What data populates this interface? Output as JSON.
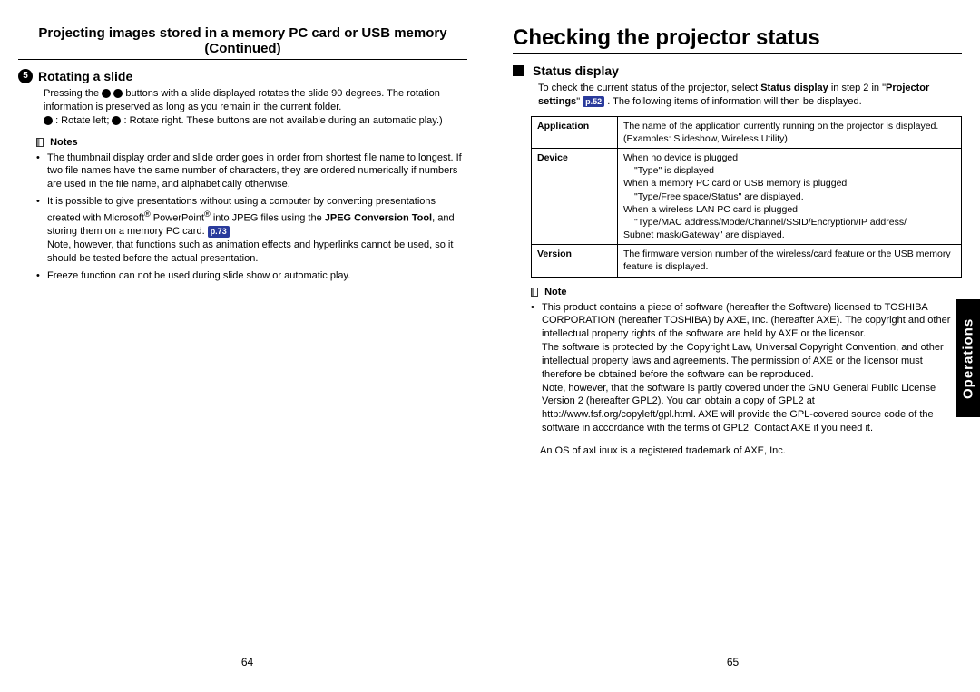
{
  "left": {
    "cont_title": "Projecting images stored in a memory PC card or USB memory (Continued)",
    "step_num": "5",
    "step_title": "Rotating a slide",
    "step_body_1": "Pressing the ",
    "step_body_2": " buttons with a slide displayed rotates the slide 90 degrees. The rotation information is preserved as long as you remain in the current folder.",
    "step_body_3": ": Rotate left; ",
    "step_body_4": ": Rotate right. These buttons are not available during an automatic play.)",
    "notes_label": "Notes",
    "notes": [
      "The thumbnail display order and slide order goes in order from shortest file name to longest. If two file names have the same number of characters, they are ordered numerically if numbers are used in the file name, and alphabetically otherwise.",
      "It is possible to give presentations without using a computer by converting presentations created with Microsoft® PowerPoint® into JPEG files using the JPEG Conversion Tool, and storing them on a memory PC card. p.73\nNote, however, that functions such as animation effects and hyperlinks cannot be used, so it should be tested before the actual presentation.",
      "Freeze function can not be used during slide show or automatic play."
    ],
    "pagenum": "64"
  },
  "right": {
    "title": "Checking the projector status",
    "sec_title": "Status display",
    "intro_1": "To check the current status of the projector, select ",
    "intro_bold": "Status display",
    "intro_2": " in step 2 in \"",
    "intro_bold2": "Projector settings",
    "intro_3": "\" ",
    "pgref": "p.52",
    "intro_4": " . The following items of information will then be displayed.",
    "table": {
      "r1k": "Application",
      "r1v": "The name of the application currently running on the projector is displayed.\n(Examples: Slideshow, Wireless Utility)",
      "r2k": "Device",
      "r2v_l1": "When no device is plugged",
      "r2v_l1b": "\"Type\" is displayed",
      "r2v_l2": "When a memory PC card or USB memory is plugged",
      "r2v_l2b": "\"Type/Free space/Status\" are displayed.",
      "r2v_l3": "When a wireless LAN PC card is plugged",
      "r2v_l3b": "\"Type/MAC address/Mode/Channel/SSID/Encryption/IP address/Subnet mask/Gateway\" are displayed.",
      "r3k": "Version",
      "r3v": "The firmware version number of the wireless/card feature or the USB memory feature is displayed."
    },
    "note_label": "Note",
    "note_body": "This product contains a piece of software (hereafter the Software) licensed to TOSHIBA CORPORATION (hereafter TOSHIBA) by AXE, Inc. (hereafter AXE). The copyright and other intellectual property rights of the software are held by AXE or the licensor.\nThe software is protected by the Copyright Law, Universal Copyright Convention, and other intellectual property laws and agreements. The permission of AXE or the licensor must therefore be obtained before the software can be reproduced.\nNote, however, that the software is partly covered under the GNU General Public License Version 2 (hereafter GPL2). You can obtain a copy of GPL2 at http://www.fsf.org/copyleft/gpl.html. AXE will provide the GPL-covered source code of the software in accordance with the terms of GPL2. Contact AXE if you need it.",
    "trademark": "An OS of axLinux is a registered trademark of AXE, Inc.",
    "sidetab": "Operations",
    "pagenum": "65"
  }
}
